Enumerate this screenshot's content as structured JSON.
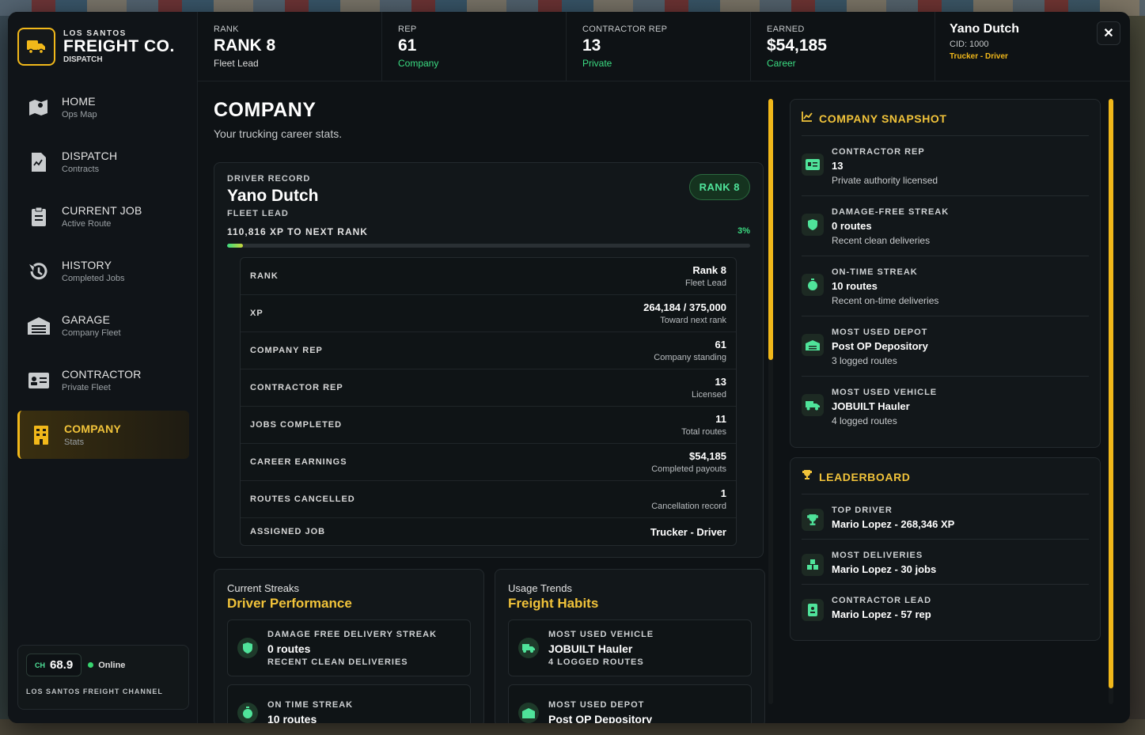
{
  "brand": {
    "small": "LOS SANTOS",
    "big": "FREIGHT CO.",
    "sub": "DISPATCH",
    "accent": "#f1b81a"
  },
  "nav": [
    {
      "title": "HOME",
      "sub": "Ops Map",
      "icon": "map-icon"
    },
    {
      "title": "DISPATCH",
      "sub": "Contracts",
      "icon": "document-icon"
    },
    {
      "title": "CURRENT JOB",
      "sub": "Active Route",
      "icon": "clipboard-icon"
    },
    {
      "title": "HISTORY",
      "sub": "Completed Jobs",
      "icon": "history-icon"
    },
    {
      "title": "GARAGE",
      "sub": "Company Fleet",
      "icon": "garage-icon"
    },
    {
      "title": "CONTRACTOR",
      "sub": "Private Fleet",
      "icon": "id-card-icon"
    },
    {
      "title": "COMPANY",
      "sub": "Stats",
      "icon": "building-icon",
      "active": true
    }
  ],
  "channel": {
    "label": "CH",
    "value": "68.9",
    "status": "Online",
    "name": "LOS SANTOS FREIGHT CHANNEL"
  },
  "header": {
    "stats": [
      {
        "label": "RANK",
        "value": "RANK 8",
        "sub": "Fleet Lead",
        "green": false
      },
      {
        "label": "REP",
        "value": "61",
        "sub": "Company",
        "green": true
      },
      {
        "label": "CONTRACTOR REP",
        "value": "13",
        "sub": "Private",
        "green": true
      },
      {
        "label": "EARNED",
        "value": "$54,185",
        "sub": "Career",
        "green": true
      }
    ],
    "profile": {
      "name": "Yano Dutch",
      "cid": "CID: 1000",
      "role": "Trucker - Driver"
    },
    "close": "✕"
  },
  "page": {
    "title": "COMPANY",
    "subtitle": "Your trucking career stats."
  },
  "record": {
    "label": "DRIVER RECORD",
    "name": "Yano Dutch",
    "role": "FLEET LEAD",
    "rank_pill": "RANK 8",
    "xp_label": "110,816 XP TO NEXT RANK",
    "xp_pct": "3%",
    "xp_progress": 0.03,
    "rows": [
      {
        "key": "RANK",
        "main": "Rank 8",
        "sub": "Fleet Lead"
      },
      {
        "key": "XP",
        "main": "264,184 / 375,000",
        "sub": "Toward next rank"
      },
      {
        "key": "COMPANY REP",
        "main": "61",
        "sub": "Company standing"
      },
      {
        "key": "CONTRACTOR REP",
        "main": "13",
        "sub": "Licensed"
      },
      {
        "key": "JOBS COMPLETED",
        "main": "11",
        "sub": "Total routes"
      },
      {
        "key": "CAREER EARNINGS",
        "main": "$54,185",
        "sub": "Completed payouts"
      },
      {
        "key": "ROUTES CANCELLED",
        "main": "1",
        "sub": "Cancellation record"
      },
      {
        "key": "ASSIGNED JOB",
        "main": "Trucker - Driver",
        "sub": ""
      }
    ]
  },
  "performance": {
    "kicker": "Current Streaks",
    "title": "Driver Performance",
    "items": [
      {
        "label": "DAMAGE FREE DELIVERY STREAK",
        "value": "0 routes",
        "sub": "RECENT CLEAN DELIVERIES",
        "icon": "shield-icon"
      },
      {
        "label": "ON TIME STREAK",
        "value": "10 routes",
        "sub": "",
        "icon": "stopwatch-icon"
      }
    ]
  },
  "habits": {
    "kicker": "Usage Trends",
    "title": "Freight Habits",
    "items": [
      {
        "label": "MOST USED VEHICLE",
        "value": "JOBUILT Hauler",
        "sub": "4 LOGGED ROUTES",
        "icon": "truck-icon"
      },
      {
        "label": "MOST USED DEPOT",
        "value": "Post OP Depository",
        "sub": "",
        "icon": "warehouse-icon"
      }
    ]
  },
  "snapshot": {
    "title": "COMPANY SNAPSHOT",
    "items": [
      {
        "label": "CONTRACTOR REP",
        "value": "13",
        "sub": "Private authority licensed",
        "icon": "id-card-icon"
      },
      {
        "label": "DAMAGE-FREE STREAK",
        "value": "0 routes",
        "sub": "Recent clean deliveries",
        "icon": "shield-icon"
      },
      {
        "label": "ON-TIME STREAK",
        "value": "10 routes",
        "sub": "Recent on-time deliveries",
        "icon": "stopwatch-icon"
      },
      {
        "label": "MOST USED DEPOT",
        "value": "Post OP Depository",
        "sub": "3 logged routes",
        "icon": "warehouse-icon"
      },
      {
        "label": "MOST USED VEHICLE",
        "value": "JOBUILT Hauler",
        "sub": "4 logged routes",
        "icon": "truck-icon"
      }
    ]
  },
  "leaderboard": {
    "title": "LEADERBOARD",
    "items": [
      {
        "label": "TOP DRIVER",
        "value": "Mario Lopez - 268,346 XP",
        "icon": "trophy-icon"
      },
      {
        "label": "MOST DELIVERIES",
        "value": "Mario Lopez - 30 jobs",
        "icon": "boxes-icon"
      },
      {
        "label": "CONTRACTOR LEAD",
        "value": "Mario Lopez - 57 rep",
        "icon": "badge-icon"
      }
    ]
  }
}
